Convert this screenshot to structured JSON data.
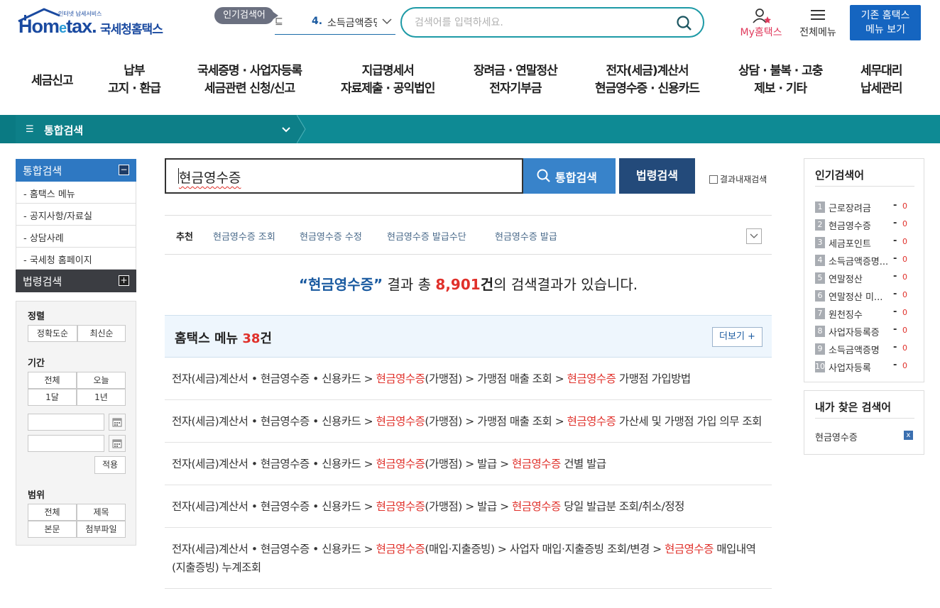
{
  "header": {
    "logo_text": "Hometax",
    "logo_tagline": "인터넷 납세서비스",
    "logo_korean": "국세청홈택스",
    "popular_badge": "인기검색어",
    "rolling_prev": "E",
    "rolling_rank": "4.",
    "rolling_keyword": "소득금액증명",
    "search_placeholder": "검색어를 입력하세요.",
    "my_hometax": "My홈택스",
    "all_menu": "전체메뉴",
    "old_menu_line1": "기존 홈택스",
    "old_menu_line2": "메뉴 보기"
  },
  "gnb": [
    {
      "line1": "세금신고",
      "line2": ""
    },
    {
      "line1": "납부",
      "line2": "고지 · 환급"
    },
    {
      "line1": "국세증명 · 사업자등록",
      "line2": "세금관련 신청/신고"
    },
    {
      "line1": "지급명세서",
      "line2": "자료제출 · 공익법인"
    },
    {
      "line1": "장려금 · 연말정산",
      "line2": "전자기부금"
    },
    {
      "line1": "전자(세금)계산서",
      "line2": "현금영수증 · 신용카드"
    },
    {
      "line1": "상담 · 불복 · 고충",
      "line2": "제보 · 기타"
    },
    {
      "line1": "세무대리",
      "line2": "납세관리"
    }
  ],
  "breadcrumb": {
    "title": "통합검색"
  },
  "lnb": {
    "head": "통합검색",
    "items": [
      "- 홈택스 메뉴",
      "- 공지사항/자료실",
      "- 상담사례",
      "- 국세청 홈페이지"
    ],
    "head2": "법령검색"
  },
  "filter": {
    "sort_title": "정렬",
    "sort_opts": [
      "정확도순",
      "최신순"
    ],
    "period_title": "기간",
    "period_opts": [
      "전체",
      "오늘",
      "1달",
      "1년"
    ],
    "apply": "적용",
    "scope_title": "범위",
    "scope_opts": [
      "전체",
      "제목",
      "본문",
      "첨부파일"
    ]
  },
  "search": {
    "query": "현금영수증",
    "btn_unified": "통합검색",
    "btn_law": "법령검색",
    "in_result": "결과내재검색"
  },
  "recommend": {
    "label": "추천",
    "keywords": [
      "현금영수증 조회",
      "현금영수증 수정",
      "현금영수증 발급수단",
      "현금영수증 발급"
    ]
  },
  "summary": {
    "q_open": "“",
    "query": "현금영수증",
    "q_close": "”",
    "pre": " 결과 총 ",
    "count": "8,901",
    "unit": "건",
    "post": "의 검색결과가 있습니다."
  },
  "menu_section": {
    "title": "홈택스 메뉴 ",
    "count": "38",
    "unit": "건",
    "more": "더보기 +"
  },
  "results": [
    [
      {
        "t": "전자(세금)계산서 • 현금영수증 • 신용카드 > ",
        "h": false
      },
      {
        "t": "현금영수증",
        "h": true
      },
      {
        "t": "(가맹점) > 가맹점 매출 조회 > ",
        "h": false
      },
      {
        "t": "현금영수증",
        "h": true
      },
      {
        "t": " 가맹점 가입방법",
        "h": false
      }
    ],
    [
      {
        "t": "전자(세금)계산서 • 현금영수증 • 신용카드 > ",
        "h": false
      },
      {
        "t": "현금영수증",
        "h": true
      },
      {
        "t": "(가맹점) > 가맹점 매출 조회 > ",
        "h": false
      },
      {
        "t": "현금영수증",
        "h": true
      },
      {
        "t": " 가산세 및 가맹점 가입 의무 조회",
        "h": false
      }
    ],
    [
      {
        "t": "전자(세금)계산서 • 현금영수증 • 신용카드 > ",
        "h": false
      },
      {
        "t": "현금영수증",
        "h": true
      },
      {
        "t": "(가맹점) > 발급 > ",
        "h": false
      },
      {
        "t": "현금영수증",
        "h": true
      },
      {
        "t": " 건별 발급",
        "h": false
      }
    ],
    [
      {
        "t": "전자(세금)계산서 • 현금영수증 • 신용카드 > ",
        "h": false
      },
      {
        "t": "현금영수증",
        "h": true
      },
      {
        "t": "(가맹점) > 발급 > ",
        "h": false
      },
      {
        "t": "현금영수증",
        "h": true
      },
      {
        "t": " 당일 발급분 조회/취소/정정",
        "h": false
      }
    ],
    [
      {
        "t": "전자(세금)계산서 • 현금영수증 • 신용카드 > ",
        "h": false
      },
      {
        "t": "현금영수증",
        "h": true
      },
      {
        "t": "(매입·지출증빙) > 사업자 매입·지출증빙 조회/변경 > ",
        "h": false
      },
      {
        "t": "현금영수증",
        "h": true
      },
      {
        "t": " 매입내역(지출증빙) 누계조회",
        "h": false
      }
    ]
  ],
  "popular": {
    "title": "인기검색어",
    "items": [
      {
        "rank": "1",
        "kw": "근로장려금",
        "dash": "-",
        "cnt": "0"
      },
      {
        "rank": "2",
        "kw": "현금영수증",
        "dash": "-",
        "cnt": "0"
      },
      {
        "rank": "3",
        "kw": "세금포인트",
        "dash": "-",
        "cnt": "0"
      },
      {
        "rank": "4",
        "kw": "소득금액증명...",
        "dash": "-",
        "cnt": "0"
      },
      {
        "rank": "5",
        "kw": "연말정산",
        "dash": "-",
        "cnt": "0"
      },
      {
        "rank": "6",
        "kw": "연말정산 미...",
        "dash": "-",
        "cnt": "0"
      },
      {
        "rank": "7",
        "kw": "원천징수",
        "dash": "-",
        "cnt": "0"
      },
      {
        "rank": "8",
        "kw": "사업자등록증",
        "dash": "-",
        "cnt": "0"
      },
      {
        "rank": "9",
        "kw": "소득금액증명",
        "dash": "-",
        "cnt": "0"
      },
      {
        "rank": "10",
        "kw": "사업자등록",
        "dash": "-",
        "cnt": "0"
      }
    ]
  },
  "my_search": {
    "title": "내가 찾은 검색어",
    "keyword": "현금영수증",
    "delete": "x"
  },
  "colors": {
    "accent_teal": "#0e8a94",
    "brand_blue": "#1a4aa0",
    "highlight_red": "#e0302a",
    "button_blue": "#3883ca",
    "button_navy": "#234a7a"
  }
}
